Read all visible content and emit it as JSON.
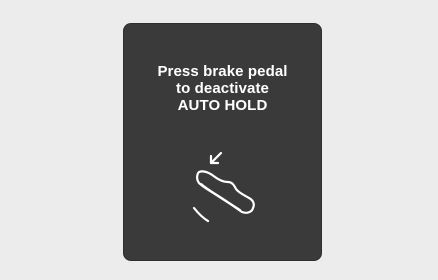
{
  "message": {
    "line1": "Press brake pedal",
    "line2": "to deactivate",
    "line3": "AUTO HOLD"
  },
  "icon": {
    "name": "foot-on-brake-pedal-icon",
    "color": "#ffffff"
  },
  "colors": {
    "background": "#ececec",
    "panel": "#3a3a3a",
    "text": "#ffffff"
  }
}
